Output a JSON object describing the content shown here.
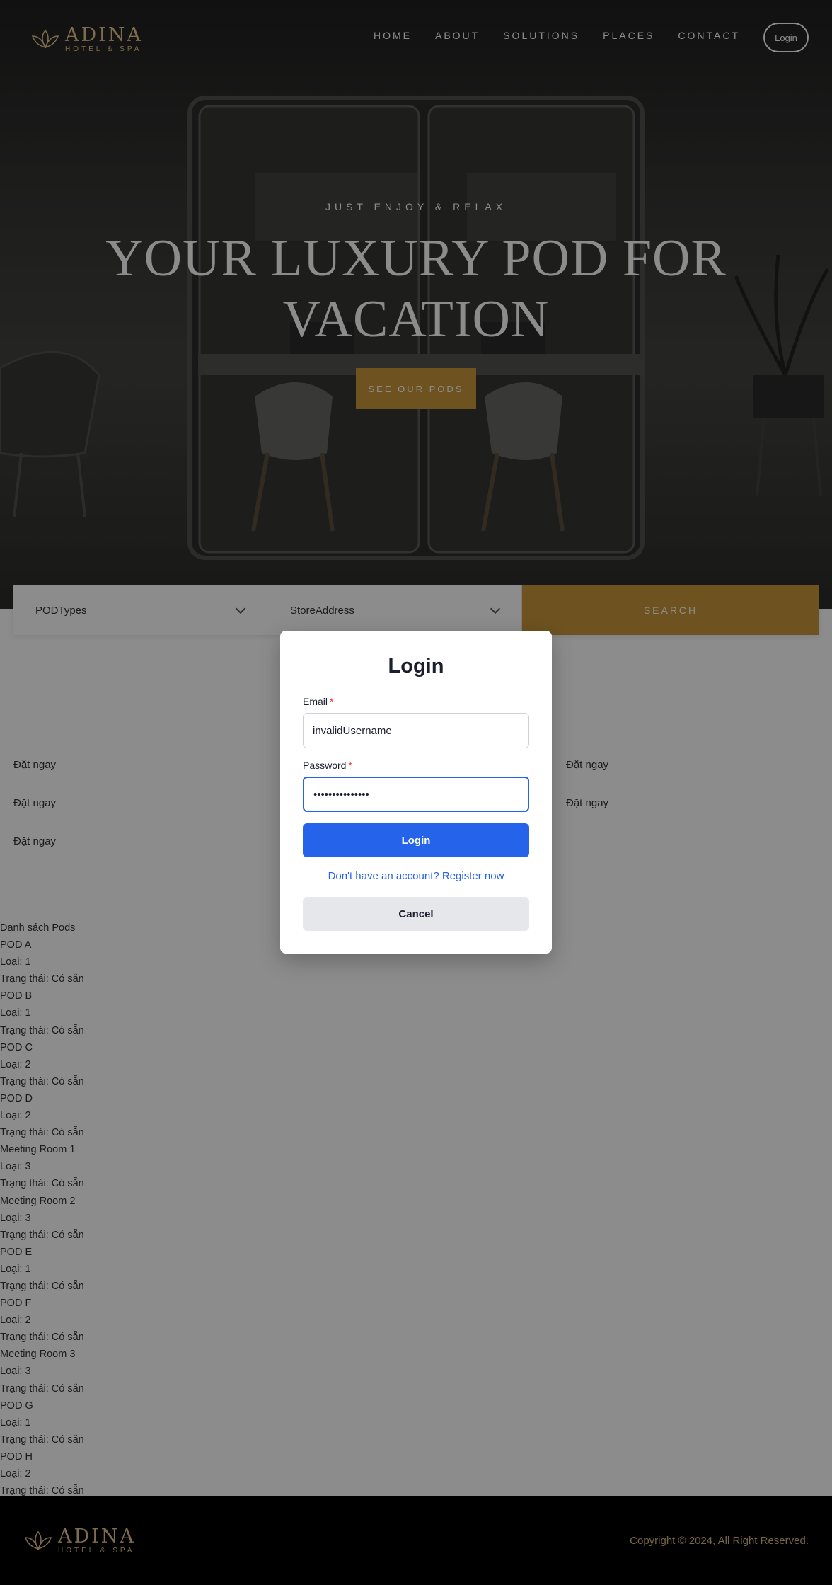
{
  "header": {
    "logo": {
      "name": "ADINA",
      "sub": "HOTEL & SPA"
    },
    "nav": [
      "HOME",
      "ABOUT",
      "SOLUTIONS",
      "PLACES",
      "CONTACT"
    ],
    "login_label": "Login"
  },
  "hero": {
    "kicker": "JUST ENJOY & RELAX",
    "title": "YOUR LUXURY POD FOR VACATION",
    "cta": "SEE OUR PODS"
  },
  "search": {
    "pod_types_value": "PODTypes",
    "store_address_value": "StoreAddress",
    "button": "SEARCH"
  },
  "book_now": {
    "label": "Đặt ngay"
  },
  "pods": {
    "heading": "Danh sách Pods",
    "items": [
      {
        "name": "POD A",
        "type": "Loại: 1",
        "status": "Trạng thái: Có sẵn"
      },
      {
        "name": "POD B",
        "type": "Loại: 1",
        "status": "Trạng thái: Có sẵn"
      },
      {
        "name": "POD C",
        "type": "Loại: 2",
        "status": "Trạng thái: Có sẵn"
      },
      {
        "name": "POD D",
        "type": "Loại: 2",
        "status": "Trạng thái: Có sẵn"
      },
      {
        "name": "Meeting Room 1",
        "type": "Loại: 3",
        "status": "Trạng thái: Có sẵn"
      },
      {
        "name": "Meeting Room 2",
        "type": "Loại: 3",
        "status": "Trạng thái: Có sẵn"
      },
      {
        "name": "POD E",
        "type": "Loại: 1",
        "status": "Trạng thái: Có sẵn"
      },
      {
        "name": "POD F",
        "type": "Loại: 2",
        "status": "Trạng thái: Có sẵn"
      },
      {
        "name": "Meeting Room 3",
        "type": "Loại: 3",
        "status": "Trạng thái: Có sẵn"
      },
      {
        "name": "POD G",
        "type": "Loại: 1",
        "status": "Trạng thái: Có sẵn"
      },
      {
        "name": "POD H",
        "type": "Loại: 2",
        "status": "Trạng thái: Có sẵn"
      }
    ]
  },
  "footer": {
    "logo": {
      "name": "ADINA",
      "sub": "HOTEL & SPA"
    },
    "copyright": "Copyright © 2024, All Right Reserved."
  },
  "modal": {
    "title": "Login",
    "email_label": "Email",
    "email_value": "invalidUsername",
    "password_label": "Password",
    "password_value": "•••••••••••••••",
    "required_mark": "*",
    "login_button": "Login",
    "register_link": "Don't have an account? Register now",
    "cancel_button": "Cancel"
  },
  "colors": {
    "accent_gold": "#c9963b",
    "primary_blue": "#2563eb",
    "footer_bg": "#000000"
  }
}
